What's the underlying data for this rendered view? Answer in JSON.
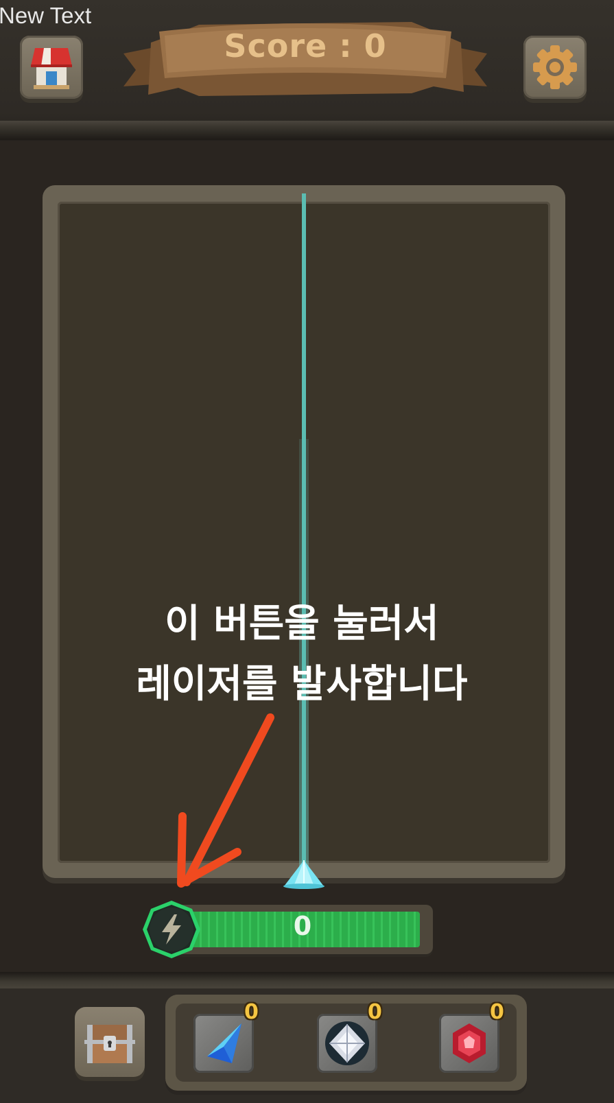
{
  "debug_label": "New Text",
  "header": {
    "score_text": "Score : 0",
    "shop_icon": "shop-icon",
    "settings_icon": "gear-icon"
  },
  "tutorial": {
    "line1": "이 버튼을 눌러서",
    "line2": "레이저를 발사합니다"
  },
  "energy": {
    "value": "0",
    "fill_fraction": 1.0,
    "button_icon": "lightning-icon"
  },
  "inventory": {
    "chest_icon": "treasure-chest-icon",
    "gems": [
      {
        "name": "blue-gem",
        "count": "0",
        "color": "#2f7de0"
      },
      {
        "name": "white-gem",
        "count": "0",
        "color": "#d9dde6"
      },
      {
        "name": "red-gem",
        "count": "0",
        "color": "#d82a3c"
      }
    ]
  },
  "colors": {
    "laser": "#5bbdb2",
    "energy_bar": "#2cae4b",
    "arrow": "#f04a1f",
    "score": "#e6c08a"
  }
}
